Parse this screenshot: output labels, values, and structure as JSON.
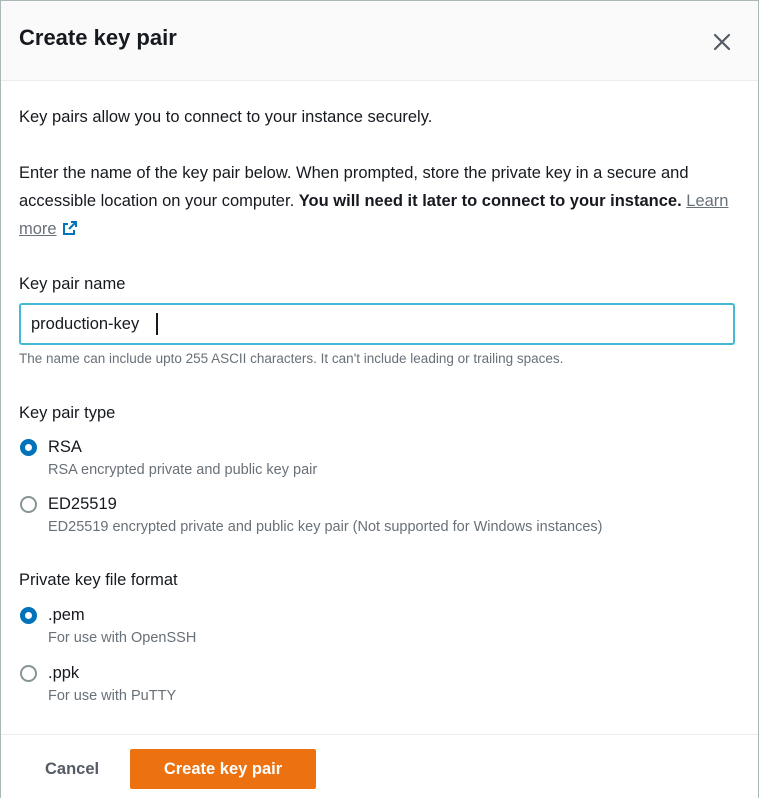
{
  "modal": {
    "title": "Create key pair",
    "intro": "Key pairs allow you to connect to your instance securely.",
    "instructions_prefix": "Enter the name of the key pair below. When prompted, store the private key in a secure and accessible location on your computer. ",
    "instructions_bold": "You will need it later to connect to your instance.",
    "learn_more": "Learn more"
  },
  "key_name": {
    "label": "Key pair name",
    "value": "production-key",
    "hint": "The name can include upto 255 ASCII characters. It can't include leading or trailing spaces."
  },
  "key_type": {
    "label": "Key pair type",
    "options": [
      {
        "label": "RSA",
        "description": "RSA encrypted private and public key pair",
        "selected": true
      },
      {
        "label": "ED25519",
        "description": "ED25519 encrypted private and public key pair (Not supported for Windows instances)",
        "selected": false
      }
    ]
  },
  "file_format": {
    "label": "Private key file format",
    "options": [
      {
        "label": ".pem",
        "description": "For use with OpenSSH",
        "selected": true
      },
      {
        "label": ".ppk",
        "description": "For use with PuTTY",
        "selected": false
      }
    ]
  },
  "footer": {
    "cancel_label": "Cancel",
    "create_label": "Create key pair"
  },
  "colors": {
    "primary_button": "#ec7211",
    "radio_selected": "#0073bb",
    "input_focus": "#44b9d6"
  },
  "icons": {
    "close": "close-icon",
    "external_link": "external-link-icon"
  }
}
